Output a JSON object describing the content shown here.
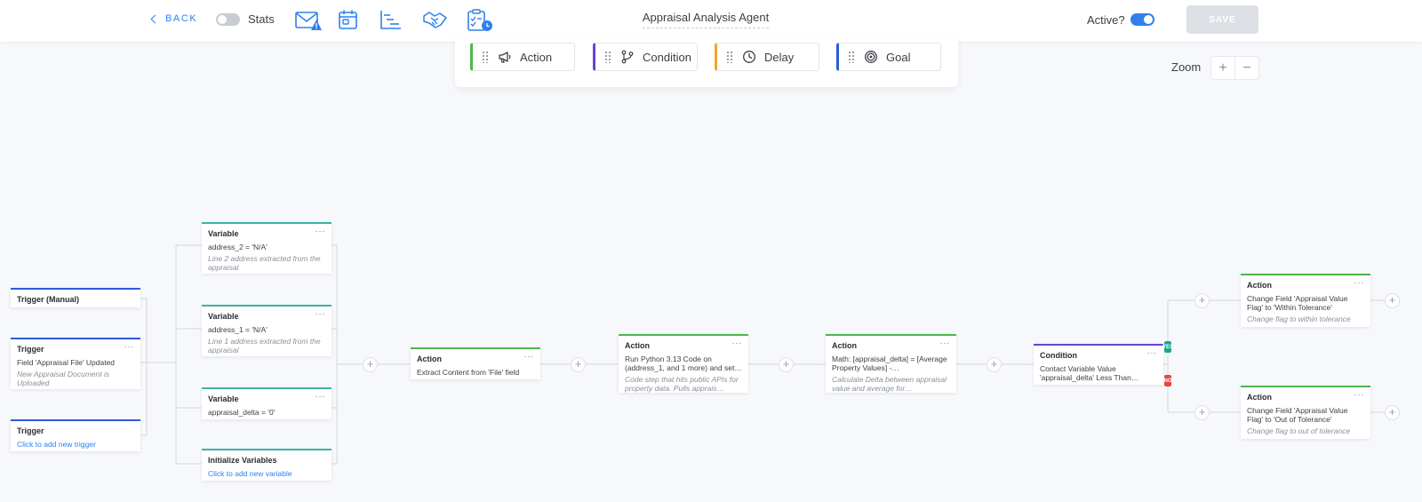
{
  "topbar": {
    "back_label": "BACK",
    "stats_label": "Stats",
    "stats_enabled": false,
    "title": "Appraisal Analysis Agent",
    "active_label": "Active?",
    "active_enabled": true,
    "save_label": "SAVE",
    "icons": [
      "email-warning-icon",
      "calendar-icon",
      "gantt-chart-icon",
      "handshake-icon",
      "checklist-clock-icon"
    ]
  },
  "palette": {
    "items": [
      {
        "label": "Action",
        "icon": "megaphone-icon",
        "color": "#4cb84c"
      },
      {
        "label": "Condition",
        "icon": "branch-icon",
        "color": "#6a42d6"
      },
      {
        "label": "Delay",
        "icon": "clock-icon",
        "color": "#f0a431"
      },
      {
        "label": "Goal",
        "icon": "target-icon",
        "color": "#2c5bd9"
      }
    ]
  },
  "zoom": {
    "label": "Zoom",
    "in": "+",
    "out": "−"
  },
  "more_glyph": "···",
  "plus_glyph": "+",
  "triggers": [
    {
      "title": "Trigger (Manual)"
    },
    {
      "title": "Trigger",
      "desc": "Field 'Appraisal File' Updated",
      "note": "New Appraisal Document is Uploaded"
    },
    {
      "title": "Trigger",
      "link": "Click to add new trigger"
    }
  ],
  "variables": [
    {
      "title": "Variable",
      "desc": "address_2 = 'N/A'",
      "note": "Line 2 address extracted from the appraisal"
    },
    {
      "title": "Variable",
      "desc": "address_1 = 'N/A'",
      "note": "Line 1 address extracted from the appraisal"
    },
    {
      "title": "Variable",
      "desc": "appraisal_delta = '0'"
    },
    {
      "title": "Initialize Variables",
      "link": "Click to add new variable"
    }
  ],
  "steps": [
    {
      "title": "Action",
      "desc": "Extract Content from 'File' field"
    },
    {
      "title": "Action",
      "desc": "Run Python 3.13 Code on (address_1, and 1 more) and set…",
      "note": "Code step that hits public APIs for property data. Pulls apprais…"
    },
    {
      "title": "Action",
      "desc": "Math: [appraisal_delta] = [Average Property Values] -…",
      "note": "Calculate Delta between appraisal value and average for…"
    },
    {
      "title": "Condition",
      "desc": "Contact Variable Value 'appraisal_delta' Less Than…"
    }
  ],
  "branches": {
    "yes_label": "YES",
    "no_label": "NO",
    "yes_color": "#1fa58f",
    "no_color": "#e84545",
    "yes": {
      "title": "Action",
      "desc": "Change Field 'Appraisal Value Flag' to 'Within Tolerance'",
      "note": "Change flag to within tolerance"
    },
    "no": {
      "title": "Action",
      "desc": "Change Field 'Appraisal Value Flag' to 'Out of Tolerance'",
      "note": "Change flag to out of tolerance"
    }
  }
}
